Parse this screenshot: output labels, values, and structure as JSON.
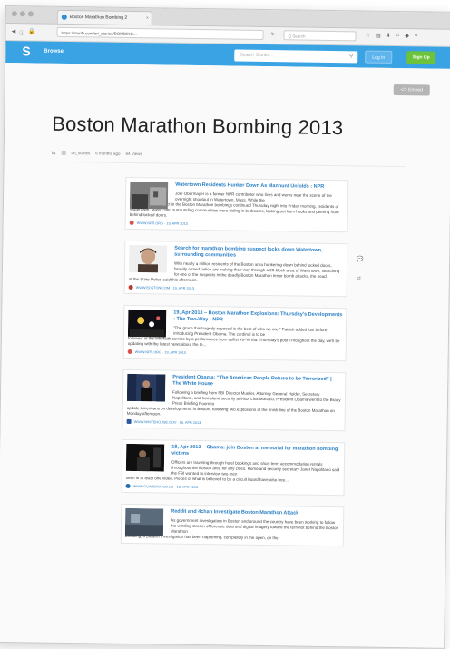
{
  "browser": {
    "tab_title": "Boston Marathon Bombing 2",
    "tab_close": "×",
    "new_tab": "+",
    "url": "https://storify.com/ori_stories/BOMBING...",
    "search_placeholder": "Q Search"
  },
  "header": {
    "logo": "S",
    "browse_label": "Browse",
    "search_placeholder": "Search Stories...",
    "login_label": "Log In",
    "signup_label": "Sign Up"
  },
  "page": {
    "embed_label": "</> Embed",
    "title": "Boston Marathon Bombing 2013",
    "byline_prefix": "by",
    "byline_user": "ori_stories",
    "byline_age": "6 months ago",
    "byline_views": "64 Views"
  },
  "stories": [
    {
      "title": "Watertown Residents Hunker Down As Manhunt Unfolds : NPR",
      "body_indent": "Joel Obermayer is a former NPR contributor who lives and works near the scene of the overnight shootout in Watertown, Mass. While the",
      "body_full": "manhunt for a suspect in the Boston Marathon bombings continued Thursday night into Friday morning, residents of Watertown, Mass., and surrounding communities were hiding in bedrooms, looking out from hooks and peering from behind locked doors.",
      "source": "WWW.NPR.ORG · 19, APR 2013",
      "src_color": "#d9534f"
    },
    {
      "title": "Search for marathon bombing suspect locks down Watertown, surrounding communities",
      "body_indent": "With nearly a million residents of the Boston area hunkering down behind locked doors, heavily armed police are making their way through a 20-block area of Watertown, searching for one of the suspects in the deadly Boston Marathon terror bomb attacks, the head",
      "body_full": "of the State Police said this afternoon.",
      "source": "WWW.BOSTON.COM · 19, APR 2013",
      "src_color": "#c0392b"
    },
    {
      "title": "19, Apr 2013 – Boston Marathon Explosions: Thursday's Developments : The Two-Way : NPR",
      "body_indent": "“The grace this tragedy exposed is the best of who we are,” Patrick added just before introducing President Obama. The cardinal is to be",
      "body_full": "followed at the interfaith service by a performance from cellist Yo-Yo Ma. Thursday's post Throughout the day, we'll be updating with the latest news about the te...",
      "source": "WWW.NPR.ORG · 19, APR 2013",
      "src_color": "#d9534f"
    },
    {
      "title": "President Obama: “The American People Refuse to be Terrorized” | The White House",
      "body_indent": "Following a briefing from FBI Director Mueller, Attorney General Holder, Secretary Napolitano, and homeland security advisor Lisa Monaco, President Obama went to the Brady Press Briefing Room to",
      "body_full": "update Americans on developments in Boston, following two explosions at the finish line of the Boston Marathon on Monday afternoon.",
      "source": "WWW.WHITEHOUSE.GOV · 16, APR 2013",
      "src_color": "#2c5aa0"
    },
    {
      "title": "18, Apr 2013 – Obama: join Boston at memorial for marathon bombing victims",
      "body_indent": "Officers are traveling through hotel bookings and short-term accommodation rentals throughout the Boston area for any clues. Homeland security secretary Janet Napolitano said the FBI wanted to interview two men",
      "body_full": "seen in at least one video. Pieces of what is believed to be a circuit board have also bee...",
      "source": "WWW.GUARDIAN.CO.UK · 18, APR 2013",
      "src_color": "#1f6fb2"
    },
    {
      "title": "Reddit and 4chan Investigate Boston Marathon Attack",
      "body_indent": "As government investigators in Boston and around the country have been working to follow the winding stream of forensic data and digital imagery toward the terrorist behind the Boston Marathon",
      "body_full": "bombing, a parallel investigation has been happening, completely in the open, on the",
      "source": "",
      "src_color": "#1f6fb2"
    }
  ]
}
